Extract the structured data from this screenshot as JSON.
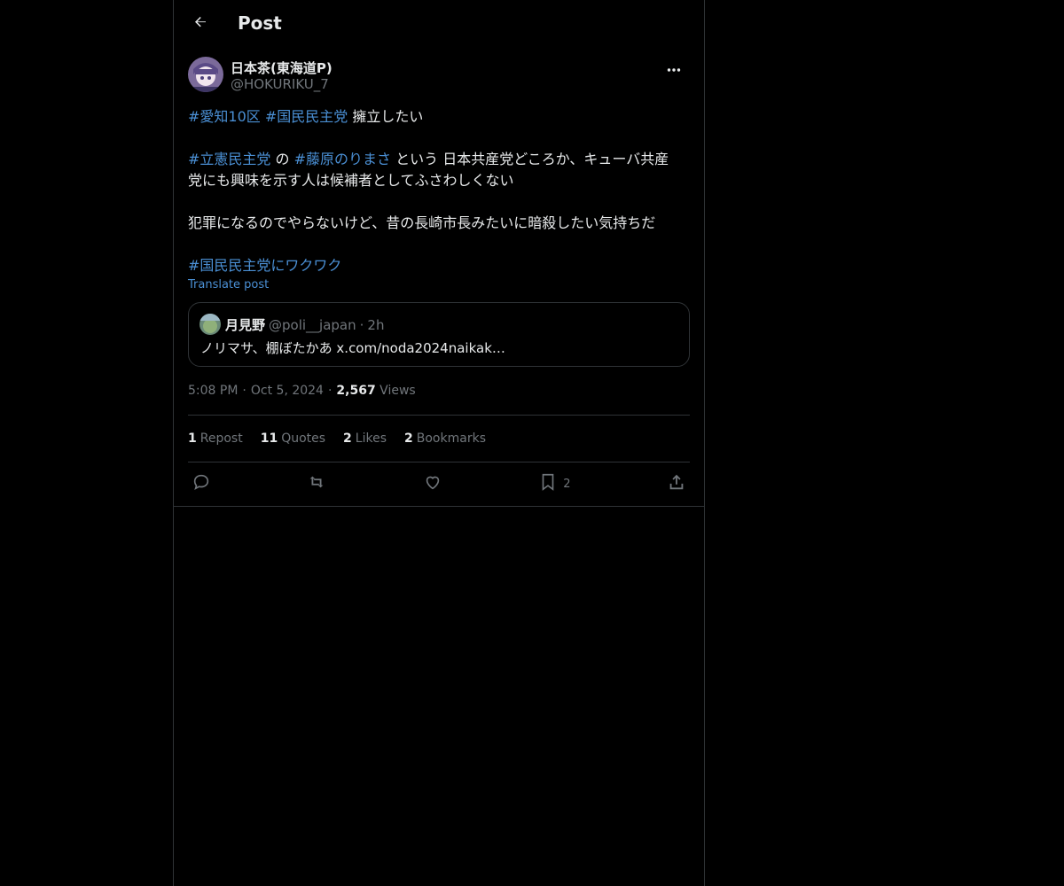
{
  "header": {
    "title": "Post"
  },
  "author": {
    "name": "日本茶(東海道P)",
    "handle": "@HOKURIKU_7"
  },
  "body": {
    "line1_tag1": "#愛知10区",
    "line1_tag2": "#国民民主党",
    "line1_text": "擁立したい",
    "line2_tag1": "#立憲民主党",
    "line2_mid": "の",
    "line2_tag2": "#藤原のりまさ",
    "line2_text_a": "という 日本共産党どころか、キューバ共産",
    "line2_text_b": "党にも興味を示す人は候補者としてふさわしくない",
    "line3_text": "犯罪になるのでやらないけど、昔の長崎市長みたいに暗殺したい気持ちだ",
    "line4_tag": "#国民民主党にワクワク"
  },
  "translate_label": "Translate post",
  "quote": {
    "name": "月見野",
    "handle": "@poli__japan",
    "dot": "·",
    "time": "2h",
    "text": "ノリマサ、棚ぼたかあ x.com/noda2024naikak…"
  },
  "meta": {
    "time": "5:08 PM",
    "sep": "·",
    "date": "Oct 5, 2024",
    "views_count": "2,567",
    "views_label": "Views"
  },
  "stats": {
    "reposts_count": "1",
    "reposts_label": "Repost",
    "quotes_count": "11",
    "quotes_label": "Quotes",
    "likes_count": "2",
    "likes_label": "Likes",
    "bookmarks_count": "2",
    "bookmarks_label": "Bookmarks"
  },
  "actions": {
    "bookmark_count": "2"
  },
  "icons": {
    "back": "arrow-left-icon",
    "more": "more-horizontal-icon",
    "reply": "reply-icon",
    "repost": "repost-icon",
    "like": "heart-icon",
    "bookmark": "bookmark-icon",
    "share": "share-icon"
  },
  "colors": {
    "link": "#4a8fd4",
    "muted": "#71767b",
    "text": "#e7e9ea",
    "border": "#2f3336"
  }
}
